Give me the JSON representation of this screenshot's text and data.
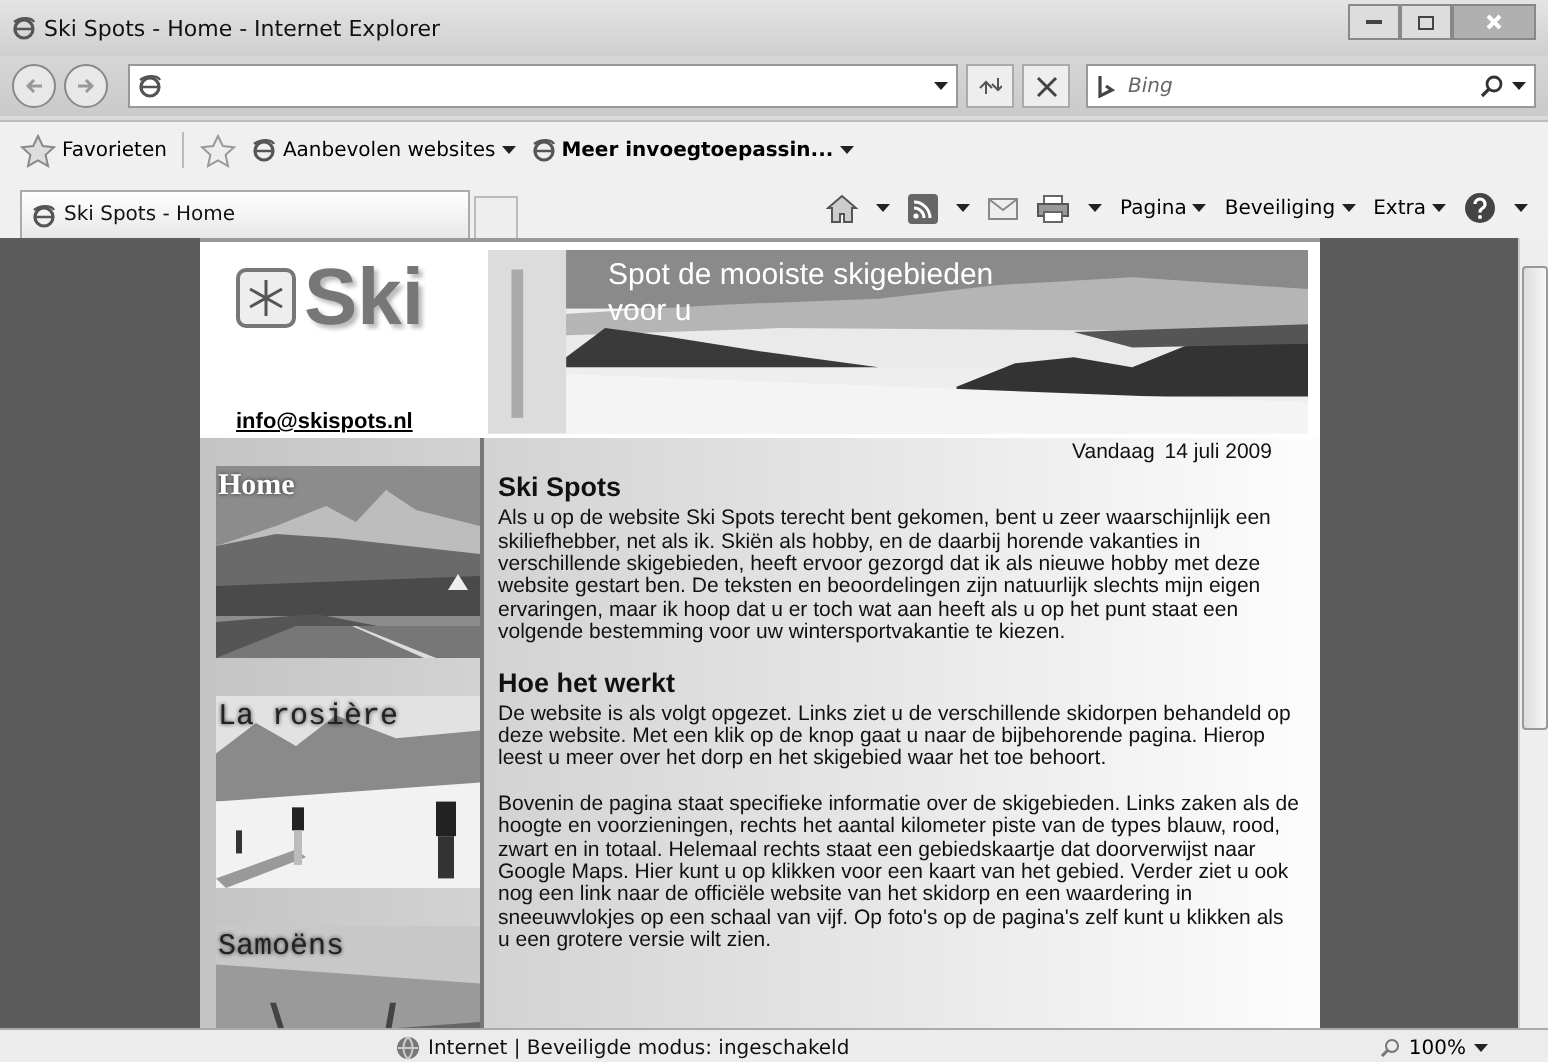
{
  "window": {
    "title": "Ski Spots - Home - Internet Explorer"
  },
  "search": {
    "placeholder": "Bing"
  },
  "favorites_bar": [
    {
      "label": "Favorieten",
      "kind": "star"
    },
    {
      "label": "Aanbevolen websites",
      "kind": "menu"
    },
    {
      "label": "Meer invoegtoepassin...",
      "kind": "addon"
    }
  ],
  "tabs": [
    {
      "label": "Ski Spots - Home",
      "selected": true
    }
  ],
  "command_bar": [
    "Pagina",
    "Beveiliging",
    "Extra"
  ],
  "page": {
    "logo": "Ski",
    "email": "info@skispots.nl",
    "banner_text": "Spot de mooiste skigebieden voor u",
    "date_label": "Vandaag",
    "date": "14 juli 2009",
    "nav": [
      {
        "label": "Home"
      },
      {
        "label": "La rosière"
      },
      {
        "label": "Samoëns"
      }
    ],
    "sections": [
      {
        "heading": "Ski Spots",
        "paragraphs": [
          "Als u op de website Ski Spots terecht bent gekomen, bent u zeer waarschijnlijk een skiliefhebber, net als ik. Skiën als hobby, en de daarbij horende vakanties in verschillende skigebieden, heeft ervoor gezorgd dat ik als nieuwe hobby met deze website gestart ben. De teksten en beoordelingen zijn natuurlijk slechts mijn eigen ervaringen, maar ik hoop dat u er toch wat aan heeft als u op het punt staat een volgende bestemming voor uw wintersportvakantie te kiezen."
        ]
      },
      {
        "heading": "Hoe het werkt",
        "paragraphs": [
          "De website is als volgt opgezet. Links ziet u de verschillende skidorpen behandeld op deze website. Met een klik op de knop gaat u naar de bijbehorende pagina. Hierop leest u meer over het dorp en het skigebied waar het toe behoort.",
          "Bovenin de pagina staat specifieke informatie over de skigebieden. Links zaken als de hoogte en voorzieningen, rechts het aantal kilometer piste van de types blauw, rood, zwart en in totaal. Helemaal rechts staat een gebiedskaartje dat doorverwijst naar Google Maps. Hier kunt u op klikken voor een kaart van het gebied. Verder ziet u ook nog een link naar de officiële website van het skidorp en een waardering in sneeuwvlokjes op een schaal van vijf. Op foto's op de pagina's zelf kunt u klikken als u een grotere versie wilt zien."
        ]
      }
    ]
  },
  "status_bar": {
    "text": "Internet | Beveiligde modus: ingeschakeld",
    "zoom": "100%"
  }
}
